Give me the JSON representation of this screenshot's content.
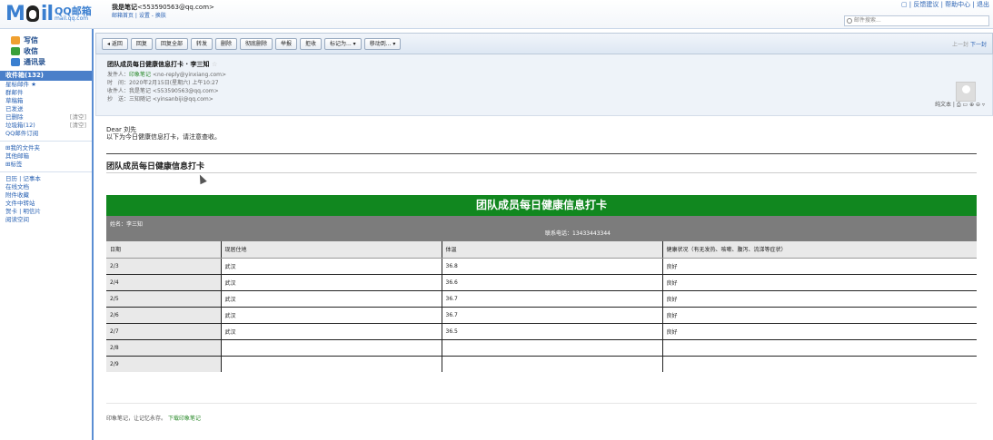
{
  "logo": {
    "big": "M",
    "mid": "il",
    "t1": "QQ邮箱",
    "t2": "mail.qq.com"
  },
  "user": {
    "name": "我是笔记",
    "email": "<553590563@qq.com>",
    "links": "邮箱首页 | 设置 - 换肤"
  },
  "top_links": "▢ | 反馈建议 | 帮助中心 | 退出",
  "search": {
    "placeholder": "邮件搜索..."
  },
  "sidebar": {
    "compose": "写信",
    "receive": "收信",
    "contacts": "通讯录",
    "inbox": "收件箱(132)",
    "items": [
      {
        "label": "星标邮件 ★",
        "extra": ""
      },
      {
        "label": "群邮件",
        "extra": ""
      },
      {
        "label": "草稿箱",
        "extra": ""
      },
      {
        "label": "已发送",
        "extra": ""
      },
      {
        "label": "已删除",
        "extra": "[清空]"
      },
      {
        "label": "垃圾箱(12)",
        "extra": "[清空]"
      },
      {
        "label": "QQ邮件订阅",
        "extra": ""
      }
    ],
    "items2": [
      {
        "label": "⊞我的文件夹"
      },
      {
        "label": "其他邮箱"
      },
      {
        "label": "⊞标签"
      }
    ],
    "items3": [
      {
        "label": "日历 | 记事本"
      },
      {
        "label": "在线文档"
      },
      {
        "label": "附件收藏"
      },
      {
        "label": "文件中转站"
      },
      {
        "label": "贺卡 | 明信片"
      },
      {
        "label": "阅读空间"
      }
    ]
  },
  "toolbar": {
    "buttons": [
      "◂ 返回",
      "回复",
      "回复全部",
      "转发",
      "删除",
      "彻底删除",
      "举报",
      "拒收",
      "标记为... ▾",
      "移动到... ▾"
    ],
    "nav_prev": "上一封",
    "nav_next": "下一封"
  },
  "mail": {
    "subject": "团队成员每日健康信息打卡 · 李三知",
    "star": "☆",
    "from_label": "发件人：",
    "from_name": "印象笔记",
    "from_addr": "<no-reply@yinxiang.com>",
    "time_label": "时　间：",
    "time": "2020年2月15日(星期六) 上午10:27",
    "to_label": "收件人：",
    "to": "我是笔记 <553590563@qq.com>",
    "cc_label": "抄　送：",
    "cc": "三知随记 <yinsanbiji@qq.com>",
    "tools": "纯文本 | ⎙ ▭ ⊕ ⊖ ▿"
  },
  "content": {
    "dear": "Dear 刘先",
    "intro": "以下为今日健康信息打卡，请注意查收。",
    "title": "团队成员每日健康信息打卡",
    "banner": "团队成员每日健康信息打卡",
    "name_label": "姓名：李三知",
    "phone_label": "联系电话：13433443344",
    "headers": [
      "日期",
      "现居住地",
      "体温",
      "健康状况（有无发热、咳嗽、腹泻、流涕等症状）"
    ],
    "rows": [
      [
        "2/3",
        "武汉",
        "36.8",
        "良好"
      ],
      [
        "2/4",
        "武汉",
        "36.6",
        "良好"
      ],
      [
        "2/5",
        "武汉",
        "36.7",
        "良好"
      ],
      [
        "2/6",
        "武汉",
        "36.7",
        "良好"
      ],
      [
        "2/7",
        "武汉",
        "36.5",
        "良好"
      ],
      [
        "2/8",
        "",
        "",
        ""
      ],
      [
        "2/9",
        "",
        "",
        ""
      ]
    ],
    "footer": "印象笔记，让记忆永存。",
    "footer_link": "下载印象笔记"
  }
}
